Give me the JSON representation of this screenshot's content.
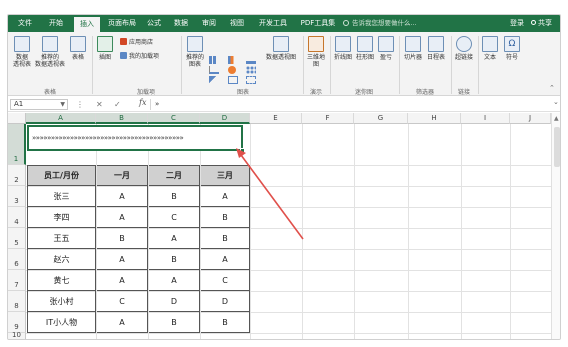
{
  "tabs": {
    "file": "文件",
    "home": "开始",
    "insert": "插入",
    "layout": "页面布局",
    "formulas": "公式",
    "data": "数据",
    "review": "审阅",
    "view": "视图",
    "developer": "开发工具",
    "pdf": "PDF工具集",
    "tellme": "告诉我您想要做什么...",
    "login": "登录",
    "share": "共享"
  },
  "ribbon": {
    "pivot": "数据\n透视表",
    "recommended_pivot": "推荐的\n数据透视表",
    "table": "表格",
    "group_tables": "表格",
    "illustrations": "插图",
    "store": "应用商店",
    "my_addins": "我的加载项",
    "group_addins": "加载项",
    "recommended_charts": "推荐的\n图表",
    "group_charts": "图表",
    "pivot_chart": "数据透视图",
    "map_3d": "三维地\n图",
    "group_tours": "演示",
    "line": "折线图",
    "column": "柱形图",
    "winloss": "盈亏",
    "group_sparklines": "迷你图",
    "slicer": "切片器",
    "timeline": "日程表",
    "group_filters": "筛选器",
    "hyperlink": "超链接",
    "group_links": "链接",
    "text": "文本",
    "symbol": "符号"
  },
  "formula_bar": {
    "name_box": "A1",
    "fx": "fx",
    "content": "»"
  },
  "columns": [
    "A",
    "B",
    "C",
    "D",
    "E",
    "F",
    "G",
    "H",
    "I",
    "J"
  ],
  "rows": [
    "1",
    "2",
    "3",
    "4",
    "5",
    "6",
    "7",
    "8",
    "9",
    "10"
  ],
  "a1_value": "»»»»»»»»»»»»»»»»»»»»»»»»»»»»»»»»»»»»»»»»",
  "table": {
    "headers": [
      "员工/月份",
      "一月",
      "二月",
      "三月"
    ],
    "rows": [
      [
        "张三",
        "A",
        "B",
        "A"
      ],
      [
        "李四",
        "A",
        "C",
        "B"
      ],
      [
        "王五",
        "B",
        "A",
        "B"
      ],
      [
        "赵六",
        "A",
        "B",
        "A"
      ],
      [
        "黄七",
        "A",
        "A",
        "C"
      ],
      [
        "张小村",
        "C",
        "D",
        "D"
      ],
      [
        "IT小人物",
        "A",
        "B",
        "B"
      ]
    ]
  },
  "colors": {
    "accent": "#217346",
    "annotation_arrow": "#e0504b",
    "header_fill": "#d0d0d0"
  }
}
